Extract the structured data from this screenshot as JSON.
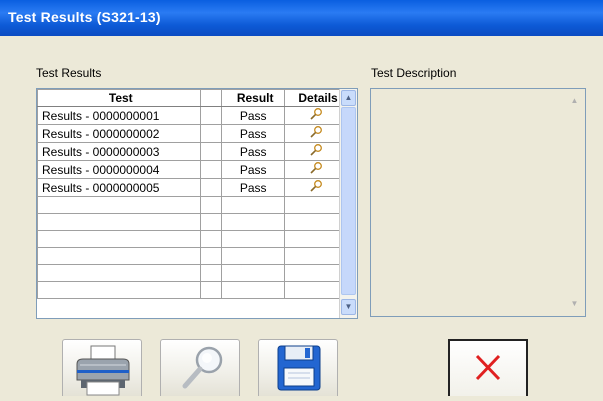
{
  "window": {
    "title": "Test Results (S321-13)"
  },
  "results": {
    "label": "Test Results",
    "columns": [
      "Test",
      "",
      "Result",
      "Details"
    ],
    "rows": [
      {
        "test": "Results - 0000000001",
        "result": "Pass",
        "details_icon": "magnifier-icon"
      },
      {
        "test": "Results - 0000000002",
        "result": "Pass",
        "details_icon": "magnifier-icon"
      },
      {
        "test": "Results - 0000000003",
        "result": "Pass",
        "details_icon": "magnifier-icon"
      },
      {
        "test": "Results - 0000000004",
        "result": "Pass",
        "details_icon": "magnifier-icon"
      },
      {
        "test": "Results - 0000000005",
        "result": "Pass",
        "details_icon": "magnifier-icon"
      }
    ]
  },
  "description": {
    "label": "Test Description",
    "value": ""
  },
  "toolbar": {
    "buttons": [
      {
        "icon": "printer-icon"
      },
      {
        "icon": "magnifier-icon"
      },
      {
        "icon": "floppy-disk-icon"
      },
      {
        "icon": "close-x-icon"
      }
    ]
  }
}
